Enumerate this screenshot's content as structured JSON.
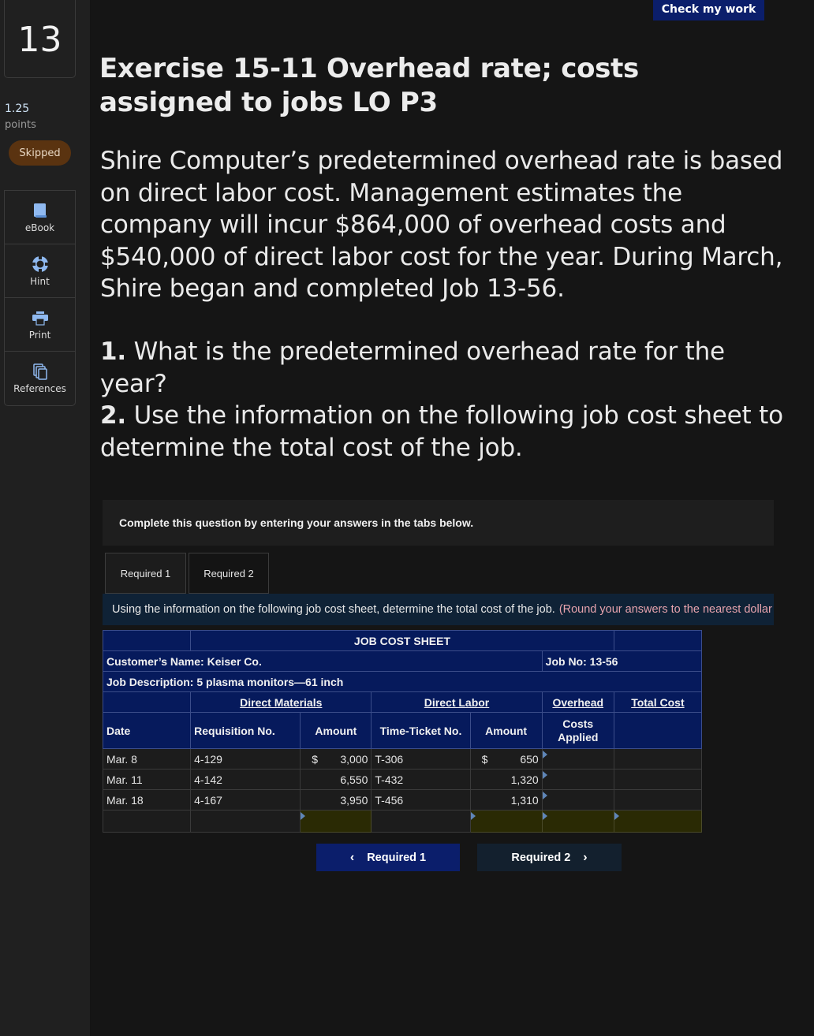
{
  "sidebar": {
    "question_number": "13",
    "points_value": "1.25",
    "points_label": "points",
    "status_badge": "Skipped",
    "tools": [
      {
        "label": "eBook",
        "icon": "book-icon"
      },
      {
        "label": "Hint",
        "icon": "lifebuoy-icon"
      },
      {
        "label": "Print",
        "icon": "printer-icon"
      },
      {
        "label": "References",
        "icon": "copy-documents-icon"
      }
    ]
  },
  "header": {
    "check_button": "Check my work"
  },
  "exercise": {
    "title": "Exercise 15-11 Overhead rate; costs assigned to jobs LO P3",
    "paragraph": "Shire Computer’s predetermined overhead rate is based on direct labor cost. Management estimates the company will incur $864,000 of overhead costs and $540,000 of direct labor cost for the year. During March, Shire began and completed Job 13-56.",
    "q1_num": "1.",
    "q1_text": " What is the predetermined overhead rate for the year?",
    "q2_num": "2.",
    "q2_text": " Use the information on the following job cost sheet to determine the total cost of the job."
  },
  "instructions": "Complete this question by entering your answers in the tabs below.",
  "tabs": [
    {
      "label": "Required 1"
    },
    {
      "label": "Required 2"
    }
  ],
  "banner": {
    "main": "Using the information on the following job cost sheet, determine the total cost of the job.",
    "note": "(Round your answers to the nearest dollar amount.)"
  },
  "job_cost_sheet": {
    "title": "JOB COST SHEET",
    "customer": "Customer’s Name: Keiser Co.",
    "job_no": "Job No: 13-56",
    "description": "Job Description: 5 plasma monitors—61 inch",
    "groups": {
      "direct_materials": "Direct Materials",
      "direct_labor": "Direct Labor",
      "overhead": "Overhead",
      "total_cost": "Total Cost"
    },
    "columns": {
      "date": "Date",
      "requisition": "Requisition No.",
      "dm_amount": "Amount",
      "time_ticket": "Time-Ticket No.",
      "dl_amount": "Amount",
      "overhead_applied": "Costs Applied"
    },
    "currency_symbol": "$",
    "rows": [
      {
        "date": "Mar. 8",
        "requisition": "4-129",
        "dm_amount": "3,000",
        "time_ticket": "T-306",
        "dl_amount": "650",
        "overhead": "",
        "total": ""
      },
      {
        "date": "Mar. 11",
        "requisition": "4-142",
        "dm_amount": "6,550",
        "time_ticket": "T-432",
        "dl_amount": "1,320",
        "overhead": "",
        "total": ""
      },
      {
        "date": "Mar. 18",
        "requisition": "4-167",
        "dm_amount": "3,950",
        "time_ticket": "T-456",
        "dl_amount": "1,310",
        "overhead": "",
        "total": ""
      }
    ],
    "totals": {
      "dm_total": "",
      "dl_total": "",
      "overhead_total": "",
      "grand_total": ""
    }
  },
  "navigation": {
    "prev_label": "Required 1",
    "next_label": "Required 2"
  },
  "colors": {
    "accent_navy": "#0b1e6b",
    "table_header": "#061a5c",
    "badge_skipped": "#5a3310",
    "note_pink": "#e7a3ad",
    "input_highlight": "#2a2a04"
  }
}
